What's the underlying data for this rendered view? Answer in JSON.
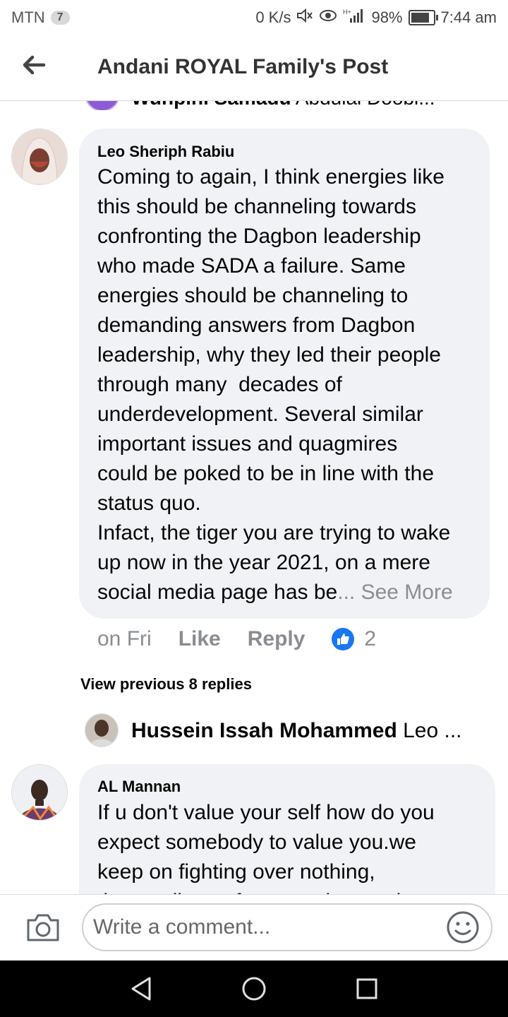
{
  "status_bar": {
    "carrier": "MTN",
    "badge": "7",
    "speed": "0 K/s",
    "battery": "98%",
    "battery_level": 0.98,
    "time": "7:44 am"
  },
  "header": {
    "title": "Andani ROYAL Family's Post"
  },
  "cut_off_reply": {
    "name": "Wunpini Samadu",
    "preview": "Abdulai Doobi..."
  },
  "comment": {
    "author": "Leo Sheriph Rabiu",
    "text": "Coming to again, I think energies like\nthis should be channeling towards\nconfronting the Dagbon leadership\nwho made SADA a failure. Same\nenergies should be channeling to\ndemanding answers from Dagbon\nleadership, why they led their people\nthrough many  decades of\nunderdevelopment. Several similar\nimportant issues and quagmires\ncould be poked to be in line with the\nstatus quo.\nInfact, the tiger you are trying to wake\nup now in the year 2021, on a mere\nsocial media page has be",
    "see_more": "... See More",
    "time": "on Fri",
    "like_label": "Like",
    "reply_label": "Reply",
    "like_count": "2"
  },
  "view_previous": "View previous 8 replies",
  "reply_preview": {
    "name": "Hussein Issah Mohammed",
    "preview": "Leo ..."
  },
  "comment2": {
    "author": "AL Mannan",
    "text": "If u don't value your self how do you\nexpect somebody to value you.we\nkeep on fighting over nothing,\nthat spoils our future and our unity"
  },
  "comment_bar": {
    "placeholder": "Write a comment..."
  },
  "colors": {
    "bubble": "#f0f2f5",
    "like_blue": "#1877f2",
    "muted": "#8a8d91"
  }
}
